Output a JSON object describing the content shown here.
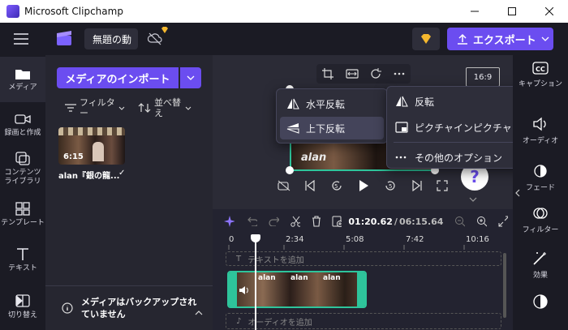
{
  "window": {
    "title": "Microsoft Clipchamp"
  },
  "topbar": {
    "project_name": "無題の動",
    "export_label": "エクスポート"
  },
  "nav": [
    {
      "label": "メディア"
    },
    {
      "label": "録画と作成"
    },
    {
      "label": "コンテンツ\nライブラリ"
    },
    {
      "label": "テンプレート"
    },
    {
      "label": "テキスト"
    },
    {
      "label": "切り替え"
    }
  ],
  "media": {
    "import_label": "メディアのインポート",
    "filter_label": "フィルター",
    "sort_label": "並べ替え",
    "clip": {
      "duration": "6:15",
      "name": "alan『銀の龍...",
      "thumb_caption": "alan"
    },
    "backup_notice": "メディアはバックアップされていません"
  },
  "preview": {
    "aspect": "16:9",
    "help": "?"
  },
  "flip_menu": {
    "horizontal": "水平反転",
    "vertical": "上下反転"
  },
  "context_menu": {
    "flip": "反転",
    "pip": "ピクチャインピクチャ",
    "more": "その他のオプション"
  },
  "timeline": {
    "current_time": "01:20.62",
    "total_time": "06:15.64",
    "ruler": [
      "0",
      "2:34",
      "5:08",
      "7:42",
      "10:16"
    ],
    "add_text": "テキストを追加",
    "add_audio": "オーディオを追加",
    "clip_caption": "alan"
  },
  "right": [
    {
      "label": "キャプション"
    },
    {
      "label": "オーディオ"
    },
    {
      "label": "フェード"
    },
    {
      "label": "フィルター"
    },
    {
      "label": "効果"
    }
  ],
  "colors": {
    "accent": "#6b4df0",
    "selection": "#2ec49b",
    "bg": "#1b1b24"
  }
}
